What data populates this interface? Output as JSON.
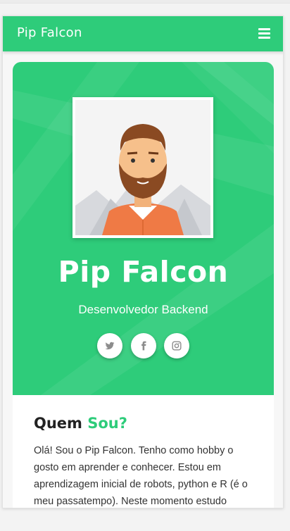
{
  "navbar": {
    "brand": "Pip Falcon",
    "menu_icon": "hamburger-icon"
  },
  "hero": {
    "name": "Pip Falcon",
    "role": "Desenvolvedor Backend",
    "avatar_icon": "avatar-illustration",
    "social": [
      {
        "name": "twitter",
        "icon": "twitter-icon"
      },
      {
        "name": "facebook",
        "icon": "facebook-icon"
      },
      {
        "name": "instagram",
        "icon": "instagram-icon"
      }
    ]
  },
  "about": {
    "title_main": "Quem",
    "title_accent": "Sou?",
    "text": "Olá! Sou o Pip Falcon. Tenho como hobby o gosto em aprender e conhecer. Estou em aprendizagem inicial de robots, python e R (é o meu passatempo). Neste momento estudo"
  },
  "colors": {
    "accent": "#2ecc7a",
    "text": "#333333",
    "heading": "#222222",
    "background": "#f3f3f3"
  }
}
